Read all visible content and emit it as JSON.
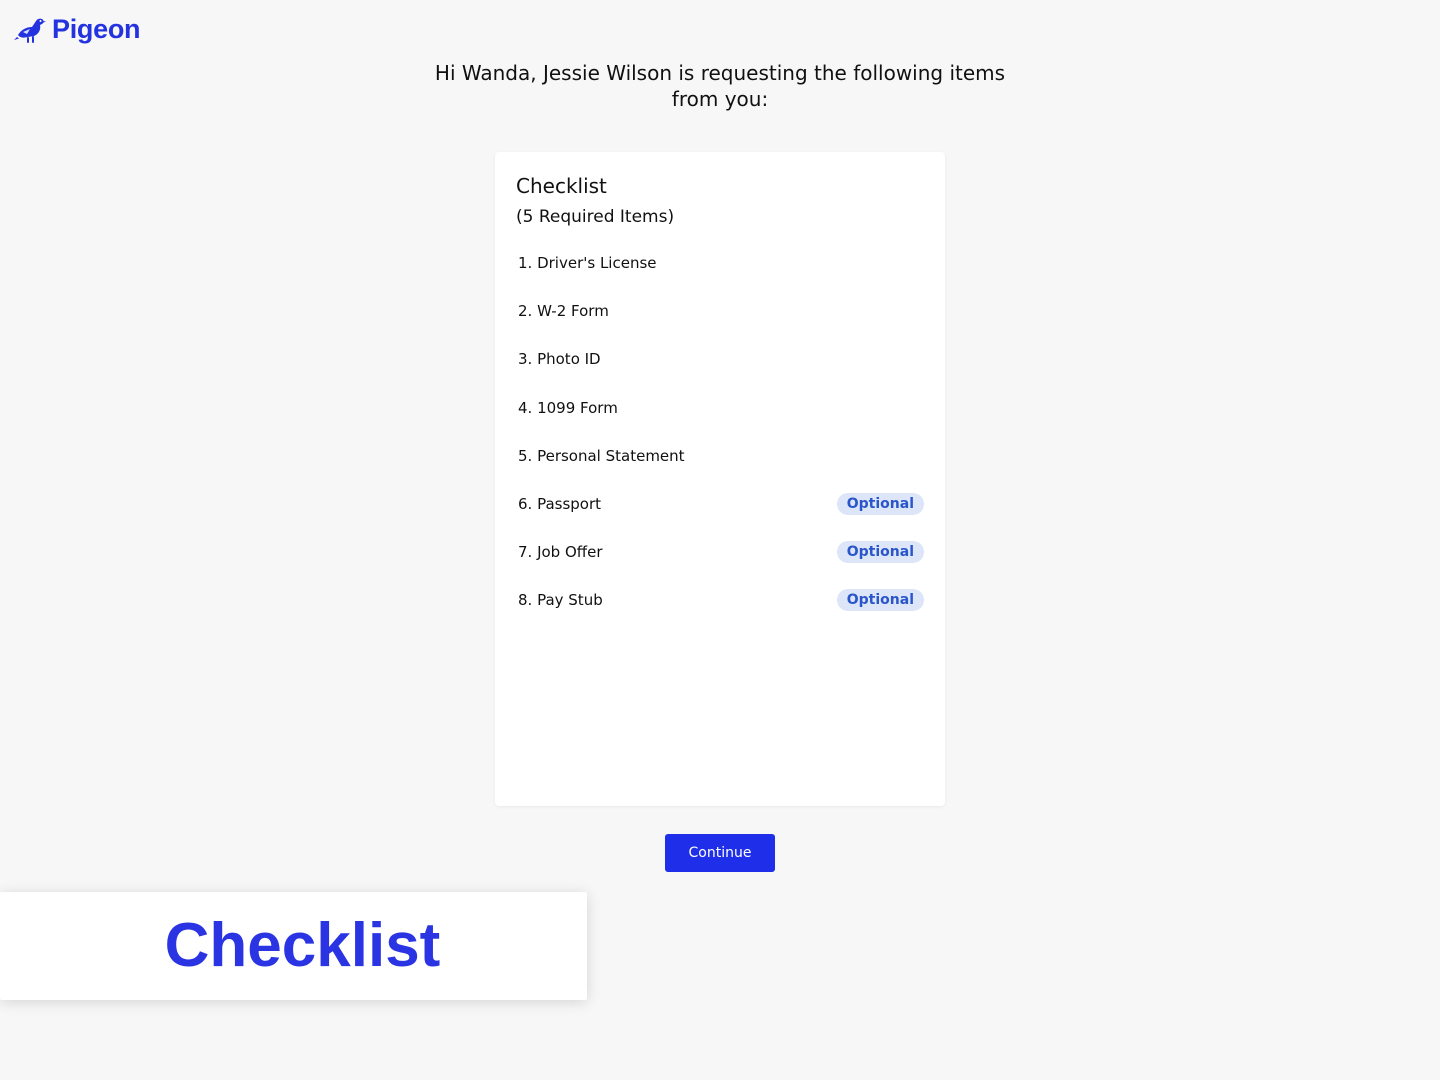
{
  "app": {
    "brand_name": "Pigeon",
    "logo_icon": "pigeon-bird-icon",
    "brand_color": "#2433e0"
  },
  "header": {
    "greeting": "Hi Wanda, Jessie Wilson is requesting the following items from you:"
  },
  "checklist": {
    "title": "Checklist",
    "subtitle": "(5 Required Items)",
    "items": [
      {
        "label": "1. Driver's License",
        "badge": ""
      },
      {
        "label": "2. W-2 Form",
        "badge": ""
      },
      {
        "label": "3. Photo ID",
        "badge": ""
      },
      {
        "label": "4. 1099 Form",
        "badge": ""
      },
      {
        "label": "5. Personal Statement",
        "badge": ""
      },
      {
        "label": "6. Passport",
        "badge": "Optional"
      },
      {
        "label": "7. Job Offer",
        "badge": "Optional"
      },
      {
        "label": "8. Pay Stub",
        "badge": "Optional"
      }
    ]
  },
  "actions": {
    "continue_label": "Continue",
    "button_color": "#1f2ee8"
  },
  "overlay": {
    "label": "Checklist"
  },
  "colors": {
    "background": "#f7f7f7",
    "badge_bg": "#dce6f8",
    "badge_text": "#2a56c9"
  }
}
